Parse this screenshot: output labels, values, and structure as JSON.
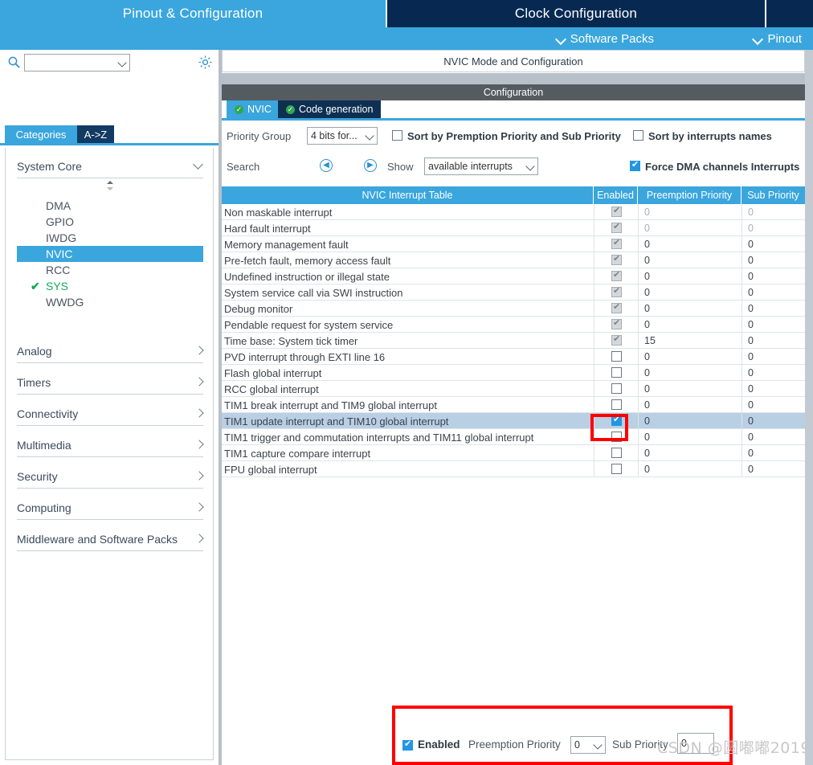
{
  "topbar": {
    "tabs": [
      {
        "label": "Pinout & Configuration",
        "active": true
      },
      {
        "label": "Clock Configuration",
        "active": false
      },
      {
        "label": "",
        "active": false
      }
    ]
  },
  "subbar": {
    "software_packs": "Software Packs",
    "pinout": "Pinout"
  },
  "sidebar": {
    "search_placeholder": "",
    "search_value": "",
    "tabs": [
      {
        "label": "Categories",
        "active": true
      },
      {
        "label": "A->Z",
        "active": false
      }
    ],
    "groups": [
      {
        "label": "System Core",
        "expanded": true
      },
      {
        "label": "Analog",
        "expanded": false
      },
      {
        "label": "Timers",
        "expanded": false
      },
      {
        "label": "Connectivity",
        "expanded": false
      },
      {
        "label": "Multimedia",
        "expanded": false
      },
      {
        "label": "Security",
        "expanded": false
      },
      {
        "label": "Computing",
        "expanded": false
      },
      {
        "label": "Middleware and Software Packs",
        "expanded": false
      }
    ],
    "peripherals": [
      {
        "label": "DMA",
        "selected": false,
        "configured": false
      },
      {
        "label": "GPIO",
        "selected": false,
        "configured": false
      },
      {
        "label": "IWDG",
        "selected": false,
        "configured": false
      },
      {
        "label": "NVIC",
        "selected": true,
        "configured": false
      },
      {
        "label": "RCC",
        "selected": false,
        "configured": false
      },
      {
        "label": "SYS",
        "selected": false,
        "configured": true
      },
      {
        "label": "WWDG",
        "selected": false,
        "configured": false
      }
    ]
  },
  "main": {
    "mode_header": "NVIC Mode and Configuration",
    "config_header": "Configuration",
    "inner_tabs": [
      {
        "label": "NVIC",
        "active": true
      },
      {
        "label": "Code generation",
        "active": false
      }
    ],
    "options": {
      "priority_group_label": "Priority Group",
      "priority_group_value": "4 bits for...",
      "sort_by_priority_label": "Sort by Premption Priority and Sub Priority",
      "sort_by_priority_checked": false,
      "sort_by_names_label": "Sort by interrupts names",
      "sort_by_names_checked": false,
      "search_label": "Search",
      "search_prev_icon": "◀",
      "search_next_icon": "▶",
      "show_label": "Show",
      "show_value": "available interrupts",
      "force_dma_label": "Force DMA channels Interrupts",
      "force_dma_checked": true
    }
  },
  "table": {
    "headers": [
      "NVIC Interrupt Table",
      "Enabled",
      "Preemption Priority",
      "Sub Priority"
    ],
    "rows": [
      {
        "name": "Non maskable interrupt",
        "enabled": true,
        "locked": true,
        "preemption": "0",
        "sub": "0",
        "dim": true,
        "selected": false
      },
      {
        "name": "Hard fault interrupt",
        "enabled": true,
        "locked": true,
        "preemption": "0",
        "sub": "0",
        "dim": true,
        "selected": false
      },
      {
        "name": "Memory management fault",
        "enabled": true,
        "locked": true,
        "preemption": "0",
        "sub": "0",
        "dim": false,
        "selected": false
      },
      {
        "name": "Pre-fetch fault, memory access fault",
        "enabled": true,
        "locked": true,
        "preemption": "0",
        "sub": "0",
        "dim": false,
        "selected": false
      },
      {
        "name": "Undefined instruction or illegal state",
        "enabled": true,
        "locked": true,
        "preemption": "0",
        "sub": "0",
        "dim": false,
        "selected": false
      },
      {
        "name": "System service call via SWI instruction",
        "enabled": true,
        "locked": true,
        "preemption": "0",
        "sub": "0",
        "dim": false,
        "selected": false
      },
      {
        "name": "Debug monitor",
        "enabled": true,
        "locked": true,
        "preemption": "0",
        "sub": "0",
        "dim": false,
        "selected": false
      },
      {
        "name": "Pendable request for system service",
        "enabled": true,
        "locked": true,
        "preemption": "0",
        "sub": "0",
        "dim": false,
        "selected": false
      },
      {
        "name": "Time base: System tick timer",
        "enabled": true,
        "locked": true,
        "preemption": "15",
        "sub": "0",
        "dim": false,
        "selected": false
      },
      {
        "name": "PVD interrupt through EXTI line 16",
        "enabled": false,
        "locked": false,
        "preemption": "0",
        "sub": "0",
        "dim": false,
        "selected": false
      },
      {
        "name": "Flash global interrupt",
        "enabled": false,
        "locked": false,
        "preemption": "0",
        "sub": "0",
        "dim": false,
        "selected": false
      },
      {
        "name": "RCC global interrupt",
        "enabled": false,
        "locked": false,
        "preemption": "0",
        "sub": "0",
        "dim": false,
        "selected": false
      },
      {
        "name": "TIM1 break interrupt and TIM9 global interrupt",
        "enabled": false,
        "locked": false,
        "preemption": "0",
        "sub": "0",
        "dim": false,
        "selected": false
      },
      {
        "name": "TIM1 update interrupt and TIM10 global interrupt",
        "enabled": true,
        "locked": false,
        "preemption": "0",
        "sub": "0",
        "dim": false,
        "selected": true
      },
      {
        "name": "TIM1 trigger and commutation interrupts and TIM11 global interrupt",
        "enabled": false,
        "locked": false,
        "preemption": "0",
        "sub": "0",
        "dim": false,
        "selected": false
      },
      {
        "name": "TIM1 capture compare interrupt",
        "enabled": false,
        "locked": false,
        "preemption": "0",
        "sub": "0",
        "dim": false,
        "selected": false
      },
      {
        "name": "FPU global interrupt",
        "enabled": false,
        "locked": false,
        "preemption": "0",
        "sub": "0",
        "dim": false,
        "selected": false
      }
    ]
  },
  "bottom_panel": {
    "enabled_label": "Enabled",
    "enabled_checked": true,
    "preemption_label": "Preemption Priority",
    "preemption_value": "0",
    "sub_label": "Sub Priority",
    "sub_value": "0"
  },
  "watermark": "CSDN @圆嘟嘟2019",
  "colors": {
    "accent_blue": "#3aa6dd",
    "dark_navy": "#072951",
    "tab_navy": "#0d2f52",
    "config_gray": "#555c61",
    "row_selected": "#b9cfe4",
    "annotation_red": "#ff0000",
    "ok_green": "#19a85b"
  }
}
